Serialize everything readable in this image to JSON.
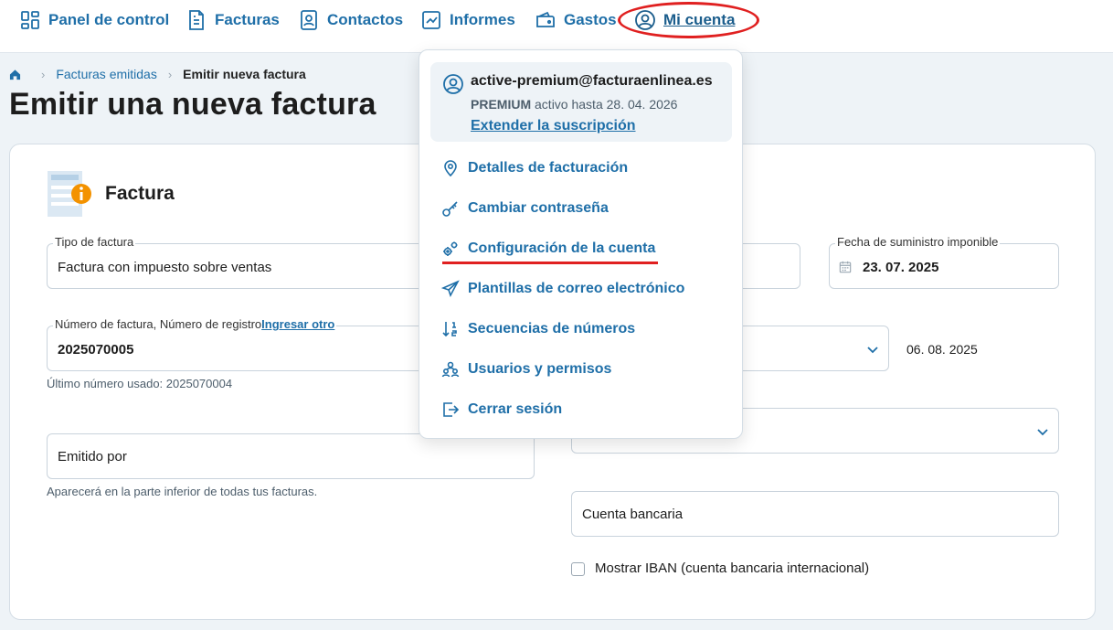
{
  "nav": {
    "items": [
      {
        "label": "Panel de control",
        "icon": "dashboard-icon"
      },
      {
        "label": "Facturas",
        "icon": "invoice-icon"
      },
      {
        "label": "Contactos",
        "icon": "contacts-icon"
      },
      {
        "label": "Informes",
        "icon": "reports-icon"
      },
      {
        "label": "Gastos",
        "icon": "wallet-icon"
      }
    ],
    "account": {
      "label": "Mi cuenta",
      "icon": "user-circle-icon"
    }
  },
  "breadcrumb": {
    "items": [
      "Facturas emitidas",
      "Emitir nueva factura"
    ]
  },
  "page": {
    "title": "Emitir una nueva factura"
  },
  "section": {
    "title": "Factura",
    "icon": "invoice-info-icon"
  },
  "form": {
    "tipo": {
      "label": "Tipo de factura",
      "value": "Factura con impuesto sobre ventas"
    },
    "fecha_suministro": {
      "label": "Fecha de suministro imponible",
      "value": "23. 07. 2025"
    },
    "numero": {
      "label": "Número de factura, Número de registro",
      "link": "Ingresar otro",
      "value": "2025070005",
      "helper": "Último número usado: 2025070004"
    },
    "due_date": "06. 08. 2025",
    "emitido_por": {
      "placeholder": "Emitido por",
      "helper": "Aparecerá en la parte inferior de todas tus facturas."
    },
    "cuenta_bancaria": {
      "placeholder": "Cuenta bancaria"
    },
    "iban": {
      "label": "Mostrar IBAN (cuenta bancaria internacional)",
      "checked": false
    }
  },
  "account_menu": {
    "email": "active-premium@facturaenlinea.es",
    "plan": "PREMIUM",
    "plan_status": "activo hasta 28. 04. 2026",
    "extend_label": "Extender la suscripción",
    "items": [
      {
        "label": "Detalles de facturación",
        "icon": "map-pin-icon"
      },
      {
        "label": "Cambiar contraseña",
        "icon": "key-icon"
      },
      {
        "label": "Configuración de la cuenta",
        "icon": "gears-icon"
      },
      {
        "label": "Plantillas de correo electrónico",
        "icon": "send-icon"
      },
      {
        "label": "Secuencias de números",
        "icon": "sort-numbers-icon"
      },
      {
        "label": "Usuarios y permisos",
        "icon": "users-icon"
      },
      {
        "label": "Cerrar sesión",
        "icon": "logout-icon"
      }
    ]
  },
  "colors": {
    "accent": "#1f6fa8",
    "highlight": "#e02020",
    "background": "#eef3f7",
    "badge": "#f39200"
  }
}
